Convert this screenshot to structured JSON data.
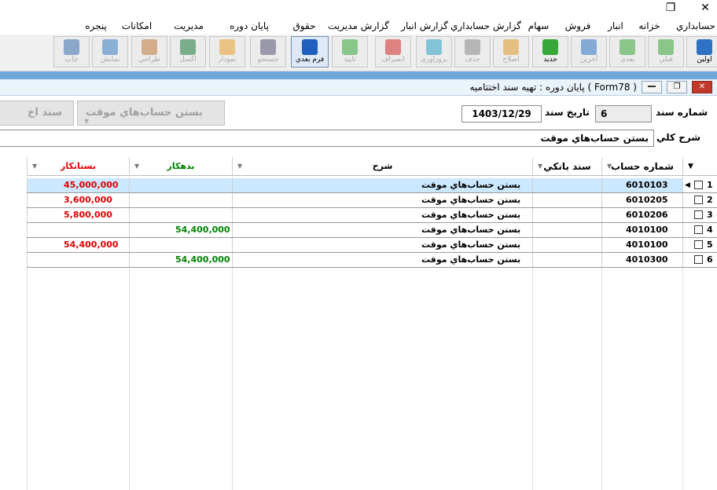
{
  "window": {
    "restore_glyph": "❐",
    "close_glyph": "✕"
  },
  "menu": [
    "حسابداري",
    "خزانه",
    "انبار",
    "فروش",
    "سهام",
    "گزارش حسابداري",
    "گزارش انبار",
    "گزارش مديريت",
    "حقوق",
    "پايان دوره",
    "مديريت",
    "امكانات",
    "پنجره"
  ],
  "toolbar": [
    {
      "label": "اولين",
      "icon": "first-arrow-icon",
      "color": "#2e72c6"
    },
    {
      "label": "قبلي",
      "icon": "prev-arrow-icon",
      "color": "#3aa53a"
    },
    {
      "label": "بعدي",
      "icon": "next-arrow-icon",
      "color": "#3aa53a"
    },
    {
      "label": "آخرين",
      "icon": "last-arrow-icon",
      "color": "#2e72c6"
    },
    {
      "label": "جديد",
      "icon": "plus-icon",
      "color": "#37a837"
    },
    {
      "label": "اصلاح",
      "icon": "pencil-icon",
      "color": "#e09a2c"
    },
    {
      "label": "حذف",
      "icon": "trash-icon",
      "color": "#8a8a8a"
    },
    {
      "label": "بروزاوري",
      "icon": "refresh-icon",
      "color": "#2fa0c8"
    },
    {
      "label": "انصراف",
      "icon": "cancel-icon",
      "color": "#d42a2a"
    },
    {
      "label": "تاييد",
      "icon": "check-icon",
      "color": "#38a838"
    },
    {
      "label": "فرم بعدي",
      "icon": "next-form-icon",
      "color": "#1f5fc0"
    },
    {
      "label": "جستجو",
      "icon": "binoculars-icon",
      "color": "#555577"
    },
    {
      "label": "نمودار",
      "icon": "chart-icon",
      "color": "#e8a030"
    },
    {
      "label": "اكسل",
      "icon": "excel-icon",
      "color": "#1d7a3a"
    },
    {
      "label": "طراحي",
      "icon": "brush-icon",
      "color": "#c0783a"
    },
    {
      "label": "نمايش",
      "icon": "preview-icon",
      "color": "#3c7fc4"
    },
    {
      "label": "چاپ",
      "icon": "printer-icon",
      "color": "#3c6fb0"
    }
  ],
  "form": {
    "title": "پايان دوره : تهيه سند اختتاميه ( Form78 )",
    "doc_number_label": "شماره سند",
    "doc_number_value": "6",
    "doc_date_label": "تاريخ سند",
    "doc_date_value": "1403/12/29",
    "doc_type_value": "بستن حساب‌هاي موقت",
    "doc_type2_value": "سند اخ",
    "description_label": "شرح كلي",
    "description_value": "بستن حساب‌هاي موقت"
  },
  "grid": {
    "columns": {
      "account": "شماره حساب",
      "bank_doc": "سند بانكي",
      "description": "شرح",
      "debit": "بدهكار",
      "credit": "بستانكار"
    },
    "rows": [
      {
        "num": "1",
        "account": "6010103",
        "description": "بستن حساب‌هاي موقت",
        "debit": "",
        "credit": "45,000,000",
        "selected": true
      },
      {
        "num": "2",
        "account": "6010205",
        "description": "بستن حساب‌هاي موقت",
        "debit": "",
        "credit": "3,600,000",
        "selected": false
      },
      {
        "num": "3",
        "account": "6010206",
        "description": "بستن حساب‌هاي موقت",
        "debit": "",
        "credit": "5,800,000",
        "selected": false
      },
      {
        "num": "4",
        "account": "4010100",
        "description": "بستن حساب‌هاي موقت",
        "debit": "54,400,000",
        "credit": "",
        "selected": false
      },
      {
        "num": "5",
        "account": "4010100",
        "description": "بستن حساب‌هاي موقت",
        "debit": "",
        "credit": "54,400,000",
        "selected": false
      },
      {
        "num": "6",
        "account": "4010300",
        "description": "بستن حساب‌هاي موقت",
        "debit": "54,400,000",
        "credit": "",
        "selected": false
      }
    ]
  }
}
